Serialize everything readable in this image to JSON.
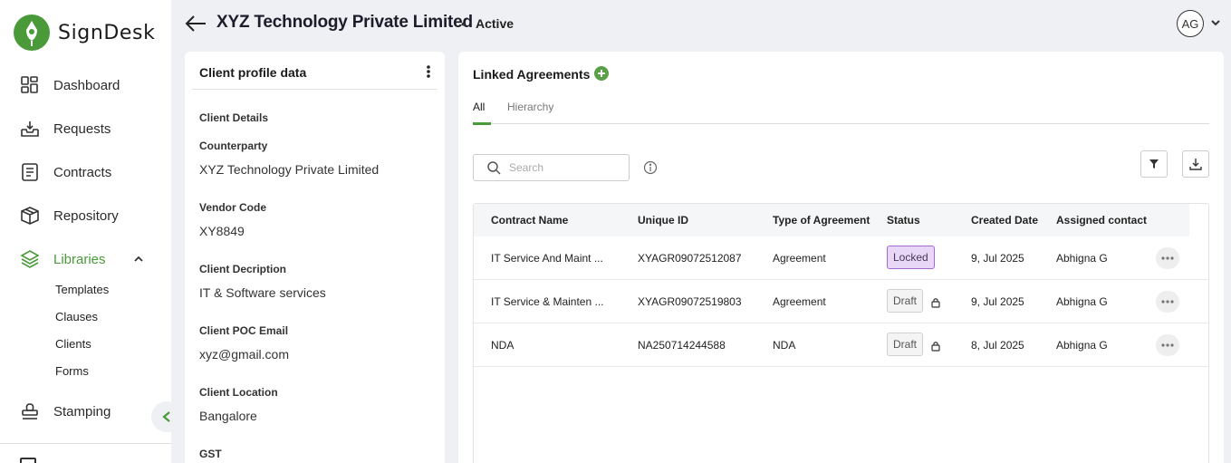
{
  "brand": {
    "name": "SignDesk",
    "accent": "#4a9a3a"
  },
  "sidebar": {
    "items": [
      {
        "label": "Dashboard",
        "icon": "dashboard-grid-icon"
      },
      {
        "label": "Requests",
        "icon": "inbox-tray-icon"
      },
      {
        "label": "Contracts",
        "icon": "document-lines-icon"
      },
      {
        "label": "Repository",
        "icon": "box-cube-icon"
      },
      {
        "label": "Libraries",
        "icon": "layers-icon",
        "active": true,
        "expanded": true
      },
      {
        "label": "Stamping",
        "icon": "stamp-icon"
      }
    ],
    "libraries_sub": [
      "Templates",
      "Clauses",
      "Clients",
      "Forms"
    ]
  },
  "header": {
    "title": "XYZ Technology Private Limited",
    "separator": "•",
    "status": "Active",
    "avatar_initials": "AG"
  },
  "profile": {
    "title": "Client profile data",
    "section": "Client Details",
    "fields": [
      {
        "label": "Counterparty",
        "value": "XYZ Technology Private Limited"
      },
      {
        "label": "Vendor Code",
        "value": "XY8849"
      },
      {
        "label": "Client Decription",
        "value": "IT & Software services"
      },
      {
        "label": "Client POC Email",
        "value": "xyz@gmail.com"
      },
      {
        "label": "Client Location",
        "value": "Bangalore"
      },
      {
        "label": "GST",
        "value": ""
      }
    ]
  },
  "agreements": {
    "title": "Linked Agreements",
    "tabs": [
      {
        "label": "All",
        "active": true
      },
      {
        "label": "Hierarchy",
        "active": false
      }
    ],
    "search_placeholder": "Search",
    "columns": [
      "Contract Name",
      "Unique ID",
      "Type of Agreement",
      "Status",
      "Created Date",
      "Assigned contact"
    ],
    "rows": [
      {
        "name": "IT Service And Maint ...",
        "id": "XYAGR09072512087",
        "type": "Agreement",
        "status": "Locked",
        "date": "9, Jul 2025",
        "contact": "Abhigna G"
      },
      {
        "name": "IT Service & Mainten ...",
        "id": "XYAGR09072519803",
        "type": "Agreement",
        "status": "Draft",
        "date": "9, Jul 2025",
        "contact": "Abhigna G"
      },
      {
        "name": "NDA",
        "id": "NA250714244588",
        "type": "NDA",
        "status": "Draft",
        "date": "8, Jul 2025",
        "contact": "Abhigna G"
      }
    ],
    "colors": {
      "locked_bg": "#e9d7f7",
      "locked_border": "#a76ad2",
      "draft_bg": "#f4f4f4"
    }
  }
}
